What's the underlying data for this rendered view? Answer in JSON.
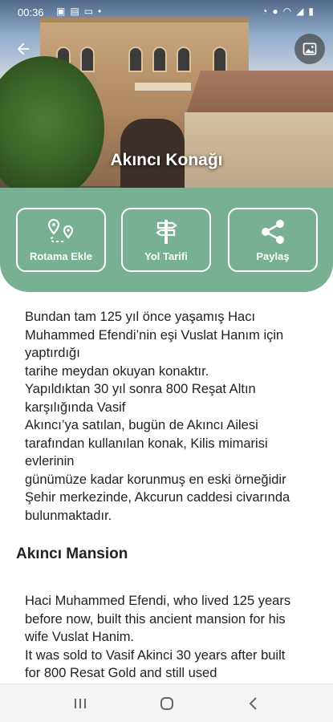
{
  "status_bar": {
    "time": "00:36",
    "left_icons": [
      "image-icon",
      "gallery-icon",
      "message-icon",
      "dot-icon"
    ],
    "right_icons": [
      "alarm-icon",
      "location-icon",
      "wifi-icon",
      "signal-icon",
      "battery-icon"
    ]
  },
  "header": {
    "title": "Akıncı Konağı"
  },
  "actions": [
    {
      "label": "Rotama Ekle",
      "icon": "route-pin-icon"
    },
    {
      "label": "Yol Tarifi",
      "icon": "signpost-icon"
    },
    {
      "label": "Paylaş",
      "icon": "share-icon"
    }
  ],
  "content": {
    "description_tr": "Bundan tam 125 yıl önce yaşamış Hacı Muhammed Efendi’nin eşi Vuslat Hanım için yaptırdığı\ntarihe meydan okuyan konaktır.\nYapıldıktan 30 yıl sonra 800 Reşat Altın karşılığında Vasif\nAkıncı’ya satılan, bugün de Akıncı Ailesi tarafından kullanılan konak, Kilis mimarisi evlerinin\ngünümüze kadar korunmuş en eski örneğidir\nŞehir merkezinde, Akcurun caddesi civarında bulunmaktadır.",
    "section_title_en": "Akıncı Mansion",
    "description_en": "Haci Muhammed Efendi, who lived 125 years before now, built this ancient mansion for his wife Vuslat Hanim.\nIt was sold to Vasif Akinci 30 years after built for 800 Resat Gold and still used"
  },
  "colors": {
    "accent_green": "#78b093",
    "text": "#222222"
  }
}
